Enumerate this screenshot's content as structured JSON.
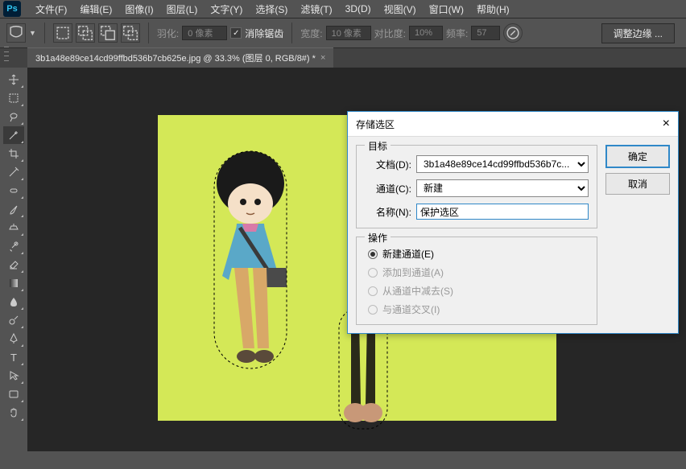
{
  "app": {
    "logo": "Ps"
  },
  "menu": [
    "文件(F)",
    "编辑(E)",
    "图像(I)",
    "图层(L)",
    "文字(Y)",
    "选择(S)",
    "滤镜(T)",
    "3D(D)",
    "视图(V)",
    "窗口(W)",
    "帮助(H)"
  ],
  "options": {
    "feather_label": "羽化:",
    "feather_value": "0 像素",
    "antialias": "消除锯齿",
    "width_label": "宽度:",
    "width_value": "10 像素",
    "contrast_label": "对比度:",
    "contrast_value": "10%",
    "frequency_label": "频率:",
    "frequency_value": "57",
    "refine": "调整边缘 ..."
  },
  "tab": {
    "title": "3b1a48e89ce14cd99ffbd536b7cb625e.jpg @ 33.3% (图层 0, RGB/8#) *",
    "close": "×"
  },
  "dialog": {
    "title": "存储选区",
    "close": "×",
    "ok": "确定",
    "cancel": "取消",
    "dest_legend": "目标",
    "doc_label": "文档(D):",
    "doc_value": "3b1a48e89ce14cd99ffbd536b7c...",
    "channel_label": "通道(C):",
    "channel_value": "新建",
    "name_label": "名称(N):",
    "name_value": "保护选区",
    "op_legend": "操作",
    "op_new": "新建通道(E)",
    "op_add": "添加到通道(A)",
    "op_sub": "从通道中减去(S)",
    "op_int": "与通道交叉(I)"
  }
}
